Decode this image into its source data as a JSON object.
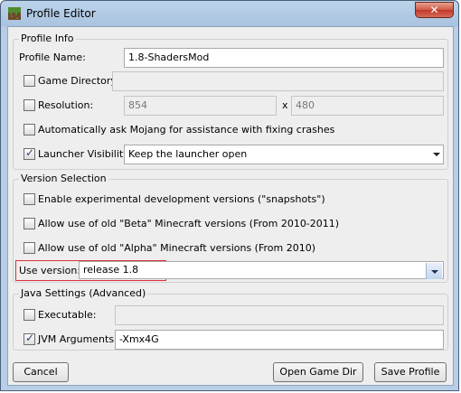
{
  "window": {
    "title": "Profile Editor"
  },
  "profile_info": {
    "legend": "Profile Info",
    "profile_name_label": "Profile Name:",
    "profile_name_value": "1.8-ShadersMod",
    "game_directory_label": "Game Directory:",
    "game_directory_checked": false,
    "resolution_label": "Resolution:",
    "resolution_checked": false,
    "resolution_width": "854",
    "resolution_x": "x",
    "resolution_height": "480",
    "auto_ask_label": "Automatically ask Mojang for assistance with fixing crashes",
    "auto_ask_checked": false,
    "launcher_visibility_label": "Launcher Visibility:",
    "launcher_visibility_checked": true,
    "launcher_visibility_value": "Keep the launcher open"
  },
  "version_selection": {
    "legend": "Version Selection",
    "snapshots_label": "Enable experimental development versions (\"snapshots\")",
    "beta_label": "Allow use of old \"Beta\" Minecraft versions (From 2010-2011)",
    "alpha_label": "Allow use of old \"Alpha\" Minecraft versions (From 2010)",
    "use_version_label": "Use version:",
    "use_version_value": "release 1.8"
  },
  "java_settings": {
    "legend": "Java Settings (Advanced)",
    "executable_label": "Executable:",
    "executable_checked": false,
    "jvm_args_label": "JVM Arguments:",
    "jvm_args_checked": true,
    "jvm_args_value": "-Xmx4G"
  },
  "buttons": {
    "cancel": "Cancel",
    "open_game_dir": "Open Game Dir",
    "save_profile": "Save Profile"
  }
}
